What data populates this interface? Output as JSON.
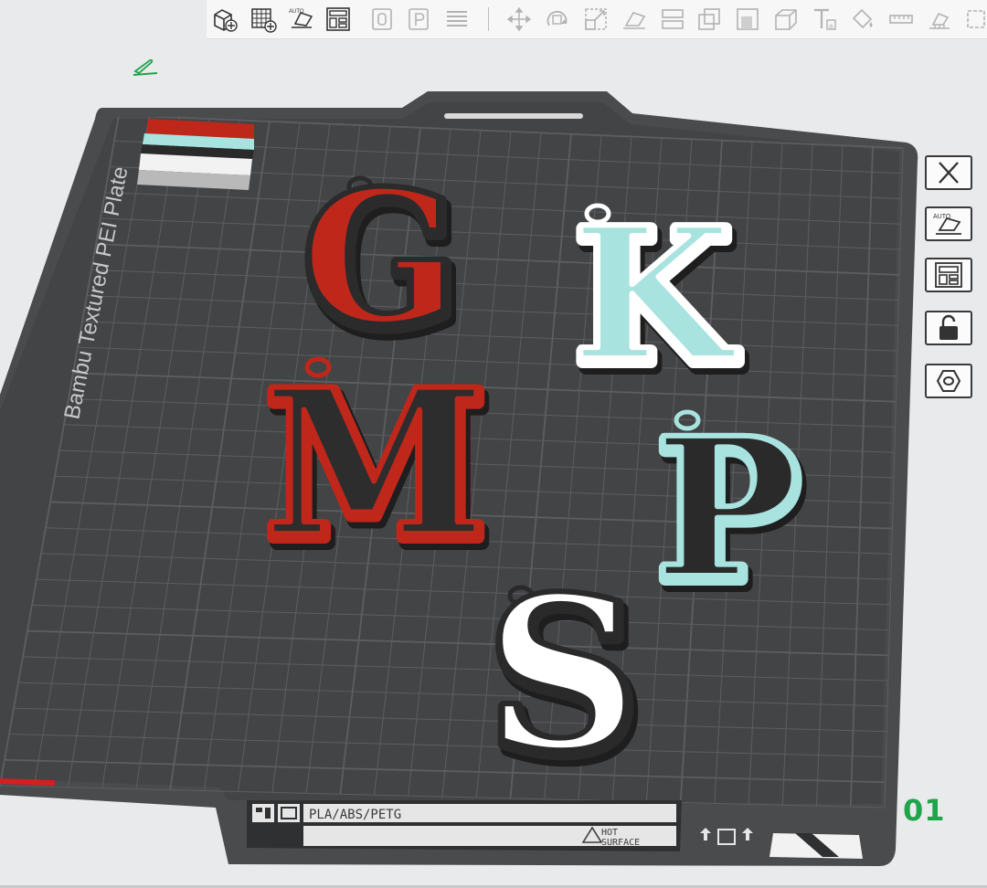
{
  "app": {
    "accent": "#1ea44a"
  },
  "toolbar": {
    "icons": [
      "add-object-icon",
      "add-plate-icon",
      "auto-orient-icon",
      "arrange-icon",
      "plate-zero-icon",
      "plate-p-icon",
      "slice-layers-icon",
      "move-icon",
      "rotate-icon",
      "scale-icon",
      "lay-on-face-icon",
      "split-to-objects-icon",
      "split-to-parts-icon",
      "cut-icon",
      "boolean-icon",
      "text-icon",
      "paint-icon",
      "measure-icon",
      "support-paint-icon",
      "seam-icon"
    ],
    "auto_label": "AUTO"
  },
  "plate": {
    "texture_label": "Bambu Textured PEI Plate",
    "filament_label": "PLA/ABS/PETG",
    "hot_surface_line1": "HOT",
    "hot_surface_line2": "SURFACE",
    "plate_number": "01",
    "colors": {
      "bed": "#434446",
      "frame": "#4a4b4d",
      "grid": "#5c5e61"
    }
  },
  "objects": [
    {
      "letter": "G",
      "face": "#c0271b",
      "edge": "#2b2b2c"
    },
    {
      "letter": "K",
      "face": "#a8e3df",
      "edge": "#ffffff"
    },
    {
      "letter": "M",
      "face": "#2d2d2e",
      "edge": "#c0271b"
    },
    {
      "letter": "P",
      "face": "#2a2a2b",
      "edge": "#a8e3df"
    },
    {
      "letter": "S",
      "face": "#ffffff",
      "edge": "#2a2a2b"
    }
  ],
  "filament_swatch": [
    "#c0271b",
    "#2a2a2b",
    "#a8e3df",
    "#2a2a2b",
    "#ffffff"
  ],
  "sidebar": {
    "items": [
      "close-icon",
      "auto-orient-plate-icon",
      "arrange-plate-icon",
      "lock-icon",
      "plate-settings-icon"
    ],
    "auto_label": "AUTO"
  }
}
